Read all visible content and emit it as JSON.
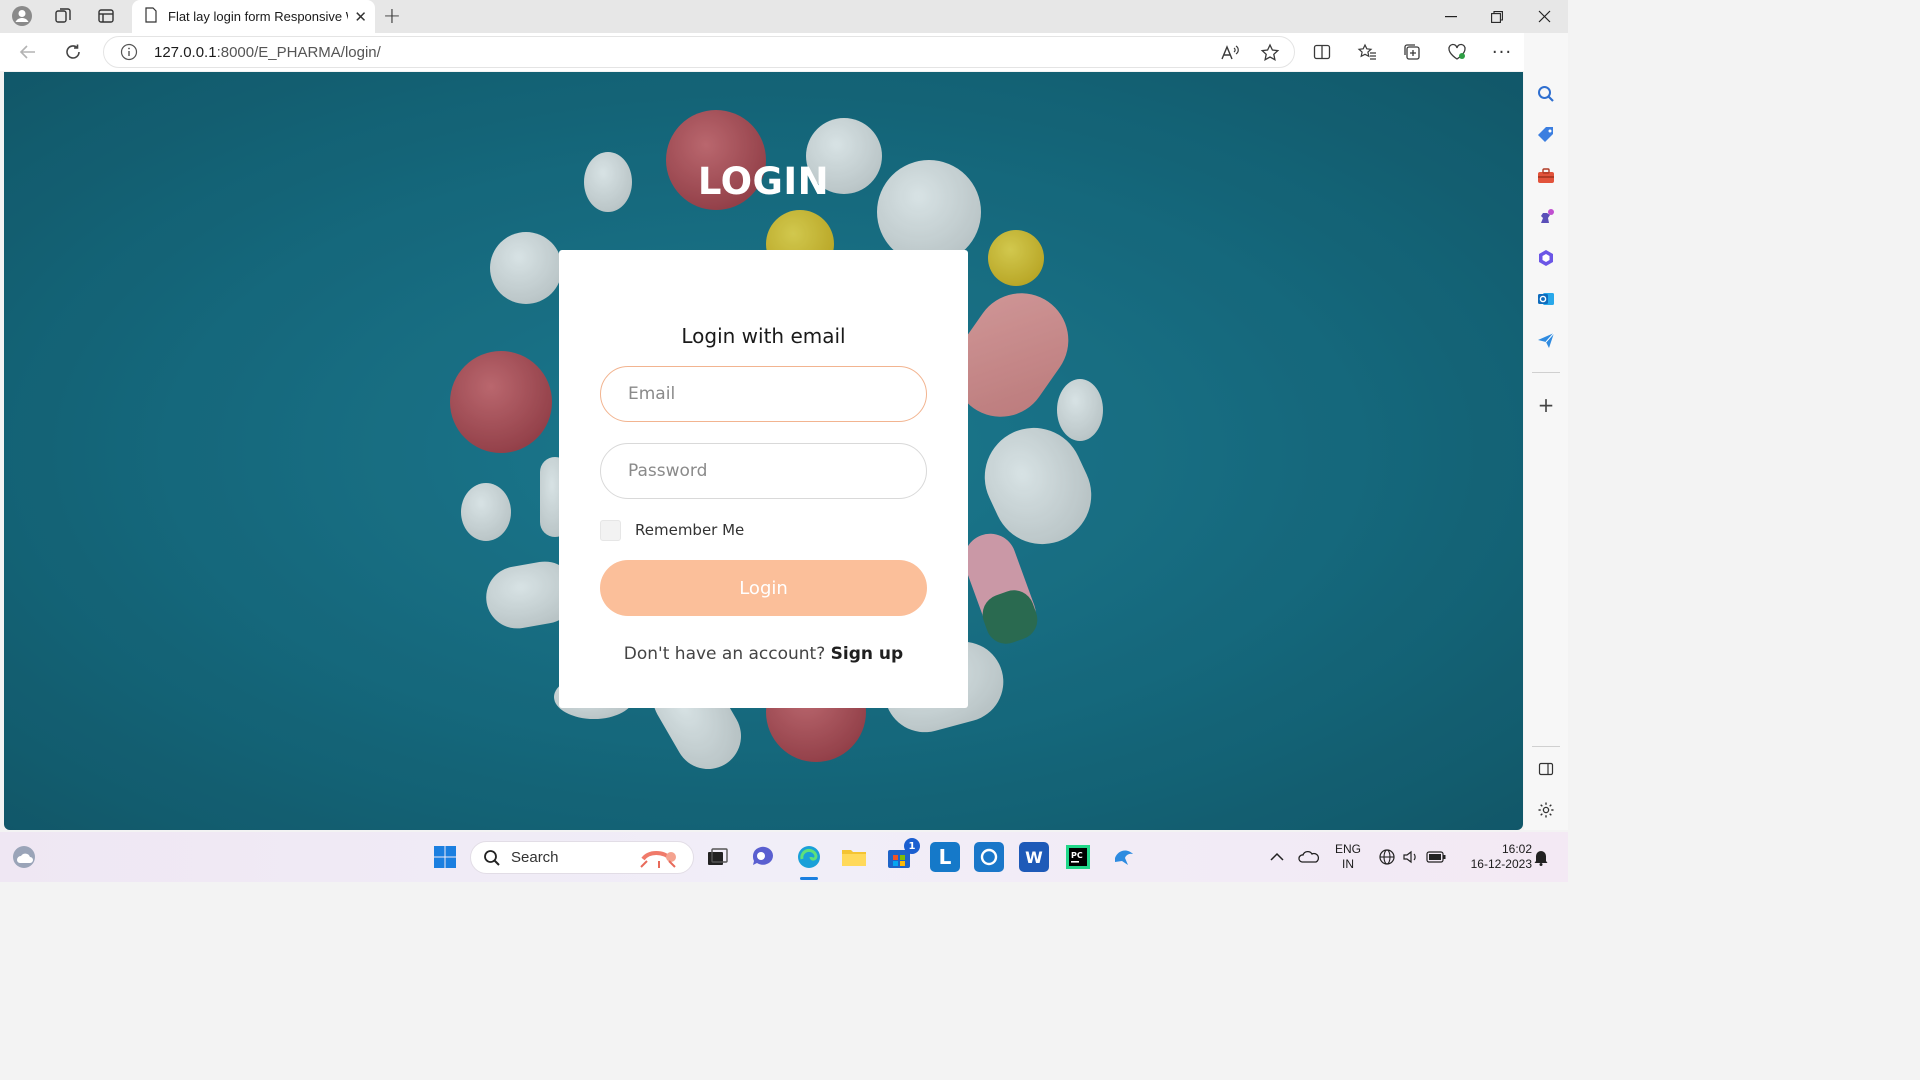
{
  "browser": {
    "tab_title": "Flat lay login form Responsive W",
    "url_host": "127.0.0.1",
    "url_rest": ":8000/E_PHARMA/login/"
  },
  "page": {
    "heading": "LOGIN",
    "card_title": "Login with email",
    "email_placeholder": "Email",
    "password_placeholder": "Password",
    "remember_label": "Remember Me",
    "remember_checked": false,
    "login_button": "Login",
    "signup_prompt": "Don't have an account?",
    "signup_link": "Sign up"
  },
  "taskbar": {
    "search_label": "Search",
    "store_badge": "1",
    "lang_line1": "ENG",
    "lang_line2": "IN",
    "time": "16:02",
    "date": "16-12-2023"
  },
  "colors": {
    "background_teal": "#176b80",
    "accent_peach": "#fbbf9a",
    "email_border": "#f2b490"
  }
}
